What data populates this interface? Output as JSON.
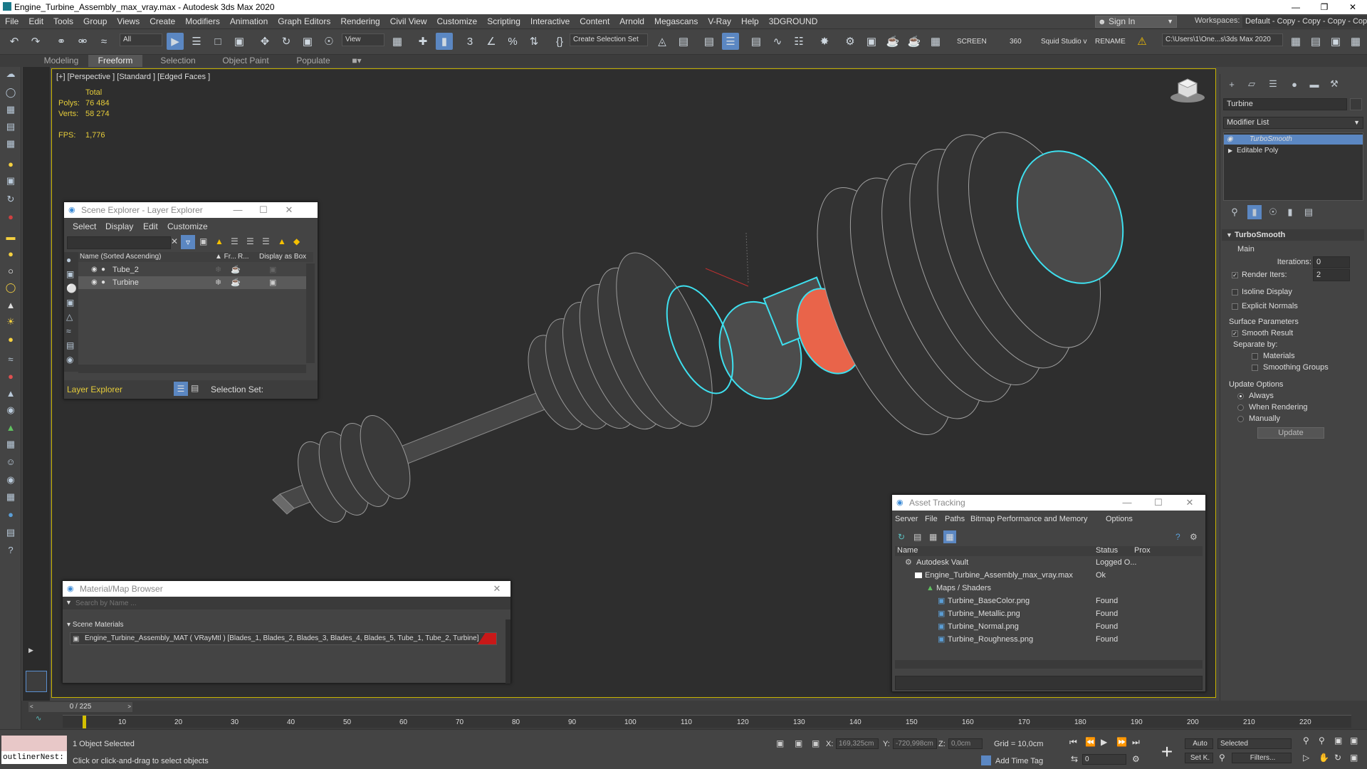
{
  "window": {
    "title": "Engine_Turbine_Assembly_max_vray.max - Autodesk 3ds Max 2020"
  },
  "menu": [
    "File",
    "Edit",
    "Tools",
    "Group",
    "Views",
    "Create",
    "Modifiers",
    "Animation",
    "Graph Editors",
    "Rendering",
    "Civil View",
    "Customize",
    "Scripting",
    "Interactive",
    "Content",
    "Arnold",
    "Megascans",
    "V-Ray",
    "Help",
    "3DGROUND"
  ],
  "signin": {
    "label": "Sign In"
  },
  "workspace": {
    "label": "Workspaces:",
    "value": "Default - Copy - Copy - Copy - Copy"
  },
  "toolbar": {
    "filter": "All",
    "ref_coord": "View",
    "selection_set": "Create Selection Set",
    "screen": "SCREEN",
    "angle": "360",
    "squid": "Squid Studio v",
    "rename": "RENAME",
    "path": "C:\\Users\\1\\One...s\\3ds Max 2020"
  },
  "ribbon": {
    "tabs": [
      "Modeling",
      "Freeform",
      "Selection",
      "Object Paint",
      "Populate"
    ]
  },
  "viewport": {
    "label": "[+] [Perspective ] [Standard ] [Edged Faces ]",
    "stats": {
      "total": "Total",
      "polys_label": "Polys:",
      "polys": "76 484",
      "verts_label": "Verts:",
      "verts": "58 274",
      "fps_label": "FPS:",
      "fps": "1,776"
    }
  },
  "scene_explorer": {
    "title": "Scene Explorer - Layer Explorer",
    "menu": [
      "Select",
      "Display",
      "Edit",
      "Customize"
    ],
    "columns": [
      "Name (Sorted Ascending)",
      "▲ Fr...",
      "R...",
      "Display as Box"
    ],
    "rows": [
      "Tube_2",
      "Turbine"
    ],
    "footer_explorer": "Layer Explorer",
    "footer_selset": "Selection Set:"
  },
  "material_browser": {
    "title": "Material/Map Browser",
    "search_placeholder": "Search by Name ...",
    "section": "Scene Materials",
    "item": "Engine_Turbine_Assembly_MAT  ( VRayMtl )  [Blades_1, Blades_2, Blades_3, Blades_4, Blades_5, Tube_1, Tube_2, Turbine]"
  },
  "asset_tracking": {
    "title": "Asset Tracking",
    "menu": [
      "Server",
      "File",
      "Paths",
      "Bitmap Performance and Memory",
      "Options"
    ],
    "columns": [
      "Name",
      "Status",
      "Prox"
    ],
    "rows": [
      {
        "name": "Autodesk Vault",
        "status": "Logged O..."
      },
      {
        "name": "Engine_Turbine_Assembly_max_vray.max",
        "status": "Ok"
      },
      {
        "name": "Maps / Shaders",
        "status": ""
      },
      {
        "name": "Turbine_BaseColor.png",
        "status": "Found"
      },
      {
        "name": "Turbine_Metallic.png",
        "status": "Found"
      },
      {
        "name": "Turbine_Normal.png",
        "status": "Found"
      },
      {
        "name": "Turbine_Roughness.png",
        "status": "Found"
      }
    ]
  },
  "command_panel": {
    "object_name": "Turbine",
    "modifier_list": "Modifier List",
    "stack": [
      "TurboSmooth",
      "Editable Poly"
    ],
    "rollout_title": "TurboSmooth",
    "main": "Main",
    "iterations_label": "Iterations:",
    "iterations": "0",
    "render_iters_label": "Render Iters:",
    "render_iters": "2",
    "isoline": "Isoline Display",
    "explicit_normals": "Explicit Normals",
    "surface_params": "Surface Parameters",
    "smooth_result": "Smooth Result",
    "separate_by": "Separate by:",
    "materials": "Materials",
    "smoothing_groups": "Smoothing Groups",
    "update_options": "Update Options",
    "always": "Always",
    "when_rendering": "When Rendering",
    "manually": "Manually",
    "update_btn": "Update"
  },
  "timeline": {
    "frame": "0 / 225",
    "ticks": [
      "10",
      "20",
      "30",
      "40",
      "50",
      "60",
      "70",
      "80",
      "90",
      "100",
      "110",
      "120",
      "130",
      "140",
      "150",
      "160",
      "170",
      "180",
      "190",
      "200",
      "210",
      "220"
    ]
  },
  "status": {
    "script_listener": "outlinerNest:",
    "selected": "1 Object Selected",
    "prompt": "Click or click-and-drag to select objects",
    "x_label": "X:",
    "x": "169,325cm",
    "y_label": "Y:",
    "y": "-720,998cm",
    "z_label": "Z:",
    "z": "0,0cm",
    "grid": "Grid = 10,0cm",
    "add_time_tag": "Add Time Tag",
    "auto": "Auto",
    "selected_dd": "Selected",
    "setk": "Set K.",
    "filters": "Filters...",
    "frame_field": "0"
  }
}
